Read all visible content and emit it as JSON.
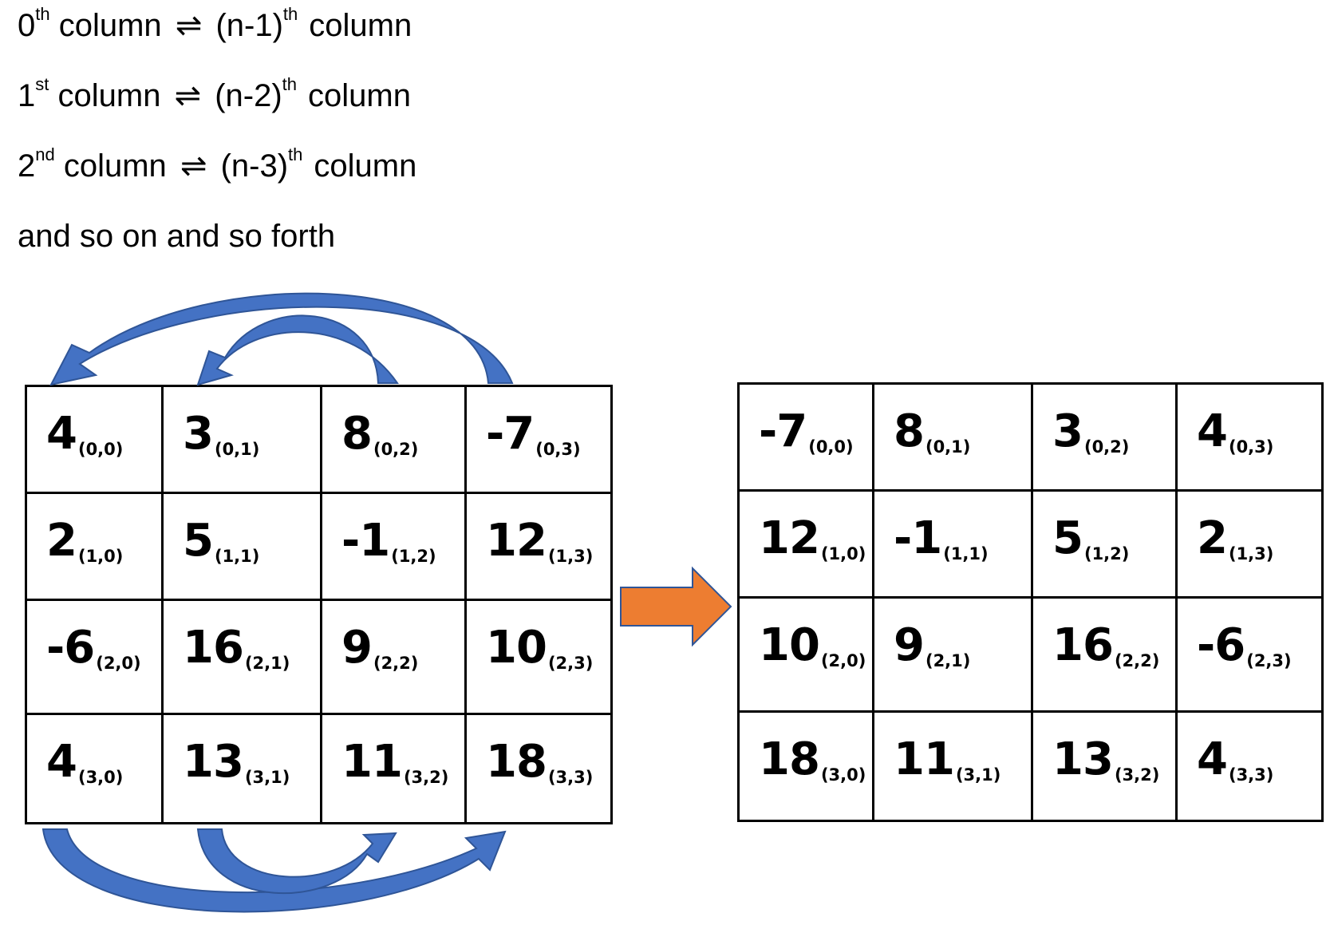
{
  "rules": [
    {
      "left_num": "0",
      "left_sup": "th",
      "left_word": "column",
      "arrow": "⇌",
      "right": "(n-1)",
      "right_sup": "th",
      "right_word": "column"
    },
    {
      "left_num": "1",
      "left_sup": "st",
      "left_word": "column",
      "arrow": "⇌",
      "right": "(n-2)",
      "right_sup": "th",
      "right_word": "column"
    },
    {
      "left_num": "2",
      "left_sup": "nd",
      "left_word": "column",
      "arrow": "⇌",
      "right": "(n-3)",
      "right_sup": "th",
      "right_word": "column"
    }
  ],
  "closing_line": "and so on and so forth",
  "matrix_before": {
    "rows": [
      [
        {
          "value": "4",
          "index": "(0,0)"
        },
        {
          "value": "3",
          "index": "(0,1)"
        },
        {
          "value": "8",
          "index": "(0,2)"
        },
        {
          "value": "-7",
          "index": "(0,3)"
        }
      ],
      [
        {
          "value": "2",
          "index": "(1,0)"
        },
        {
          "value": "5",
          "index": "(1,1)"
        },
        {
          "value": "-1",
          "index": "(1,2)"
        },
        {
          "value": "12",
          "index": "(1,3)"
        }
      ],
      [
        {
          "value": "-6",
          "index": "(2,0)"
        },
        {
          "value": "16",
          "index": "(2,1)"
        },
        {
          "value": "9",
          "index": "(2,2)"
        },
        {
          "value": "10",
          "index": "(2,3)"
        }
      ],
      [
        {
          "value": "4",
          "index": "(3,0)"
        },
        {
          "value": "13",
          "index": "(3,1)"
        },
        {
          "value": "11",
          "index": "(3,2)"
        },
        {
          "value": "18",
          "index": "(3,3)"
        }
      ]
    ]
  },
  "matrix_after": {
    "rows": [
      [
        {
          "value": "-7",
          "index": "(0,0)"
        },
        {
          "value": "8",
          "index": "(0,1)"
        },
        {
          "value": "3",
          "index": "(0,2)"
        },
        {
          "value": "4",
          "index": "(0,3)"
        }
      ],
      [
        {
          "value": "12",
          "index": "(1,0)"
        },
        {
          "value": "-1",
          "index": "(1,1)"
        },
        {
          "value": "5",
          "index": "(1,2)"
        },
        {
          "value": "2",
          "index": "(1,3)"
        }
      ],
      [
        {
          "value": "10",
          "index": "(2,0)"
        },
        {
          "value": "9",
          "index": "(2,1)"
        },
        {
          "value": "16",
          "index": "(2,2)"
        },
        {
          "value": "-6",
          "index": "(2,3)"
        }
      ],
      [
        {
          "value": "18",
          "index": "(3,0)"
        },
        {
          "value": "11",
          "index": "(3,1)"
        },
        {
          "value": "13",
          "index": "(3,2)"
        },
        {
          "value": "4",
          "index": "(3,3)"
        }
      ]
    ]
  },
  "colors": {
    "swap_arrow": "#4472C4",
    "swap_arrow_edge": "#2F5597",
    "transform_arrow": "#ED7D31",
    "transform_arrow_edge": "#2F5597"
  }
}
